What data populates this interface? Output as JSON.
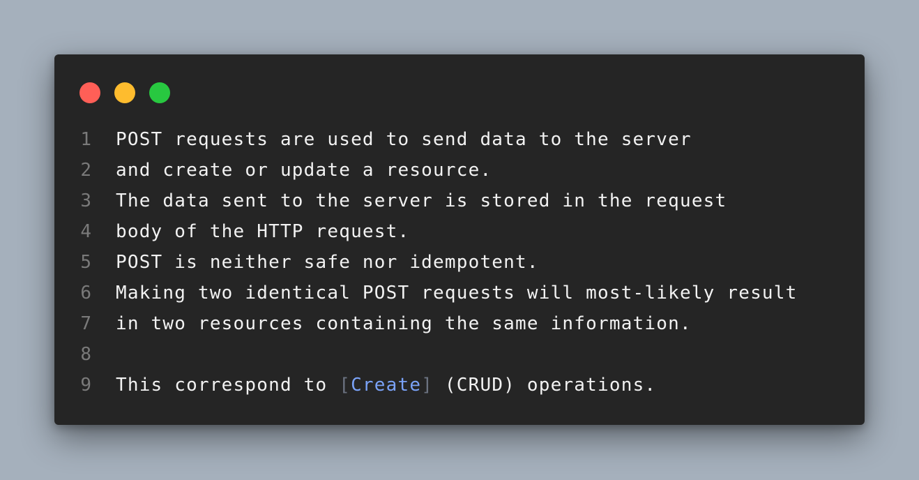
{
  "window": {
    "controls": {
      "close_color": "#ff5f57",
      "minimize_color": "#febc2e",
      "zoom_color": "#28c840"
    }
  },
  "code": {
    "lines": [
      {
        "number": "1",
        "text": "POST requests are used to send data to the server"
      },
      {
        "number": "2",
        "text": "and create or update a resource."
      },
      {
        "number": "3",
        "text": "The data sent to the server is stored in the request"
      },
      {
        "number": "4",
        "text": "body of the HTTP request."
      },
      {
        "number": "5",
        "text": "POST is neither safe nor idempotent."
      },
      {
        "number": "6",
        "text": "Making two identical POST requests will most-likely result"
      },
      {
        "number": "7",
        "text": "in two resources containing the same information."
      },
      {
        "number": "8",
        "text": ""
      },
      {
        "number": "9",
        "prefix": "This correspond to ",
        "open_bracket": "[",
        "link": "Create",
        "close_bracket": "]",
        "suffix": " (CRUD) operations."
      }
    ]
  },
  "colors": {
    "background": "#a5b0bc",
    "window": "#252525",
    "text": "#f2f2f2",
    "line_number": "#7a7a7a",
    "link": "#7aa2f7",
    "bracket": "#6b7280"
  }
}
